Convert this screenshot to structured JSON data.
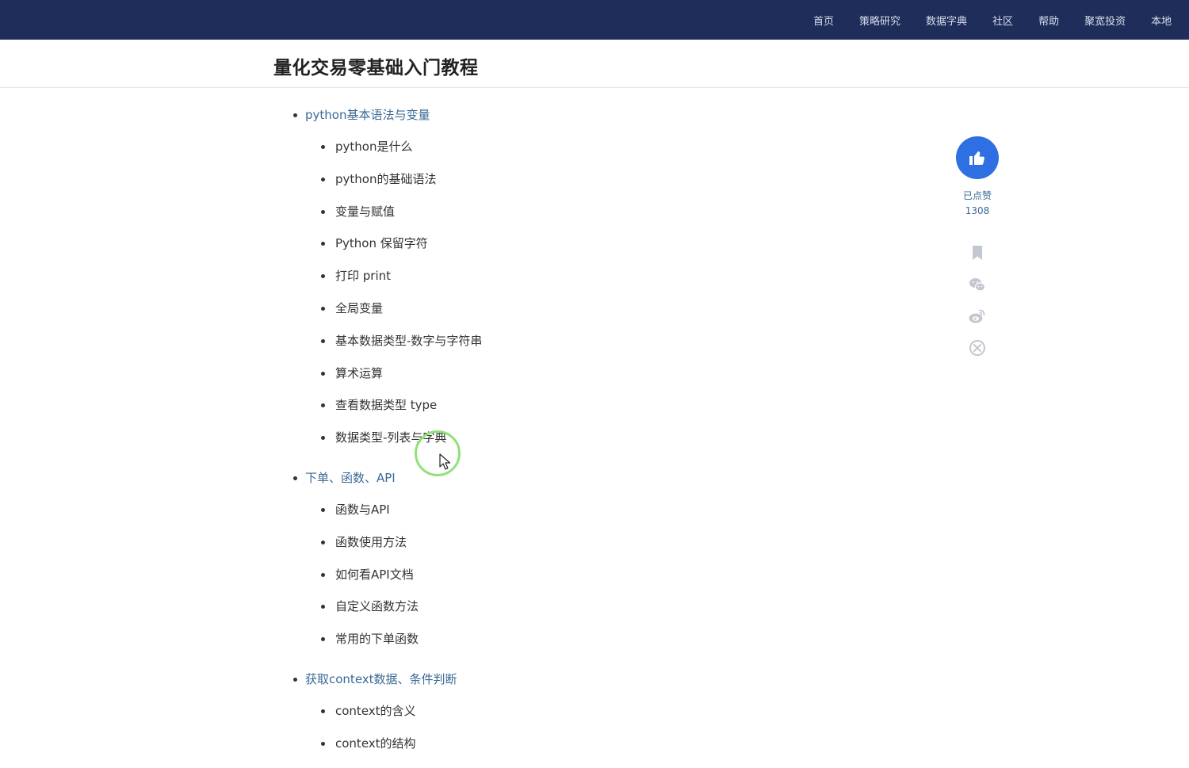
{
  "nav": {
    "items": [
      "首页",
      "策略研究",
      "数据字典",
      "社区",
      "帮助",
      "聚宽投资",
      "本地"
    ]
  },
  "page": {
    "title": "量化交易零基础入门教程"
  },
  "toc": {
    "sections": [
      {
        "title": "python基本语法与变量",
        "items": [
          "python是什么",
          "python的基础语法",
          "变量与赋值",
          "Python 保留字符",
          "打印 print",
          "全局变量",
          "基本数据类型-数字与字符串",
          "算术运算",
          "查看数据类型 type",
          "数据类型-列表与字典"
        ]
      },
      {
        "title": "下单、函数、API",
        "items": [
          "函数与API",
          "函数使用方法",
          "如何看API文档",
          "自定义函数方法",
          "常用的下单函数"
        ]
      },
      {
        "title": "获取context数据、条件判断",
        "items": [
          "context的含义",
          "context的结构"
        ]
      }
    ]
  },
  "sidebar": {
    "like_status": "已点赞",
    "like_count": "1308",
    "icons": [
      "bookmark-icon",
      "wechat-icon",
      "weibo-icon",
      "share-icon"
    ]
  },
  "colors": {
    "topbar": "#1e2d5a",
    "link": "#3a6a96",
    "like_button": "#2f6fe4",
    "side_icon": "#c3c8d0",
    "cursor_ring": "#8fe27a"
  }
}
